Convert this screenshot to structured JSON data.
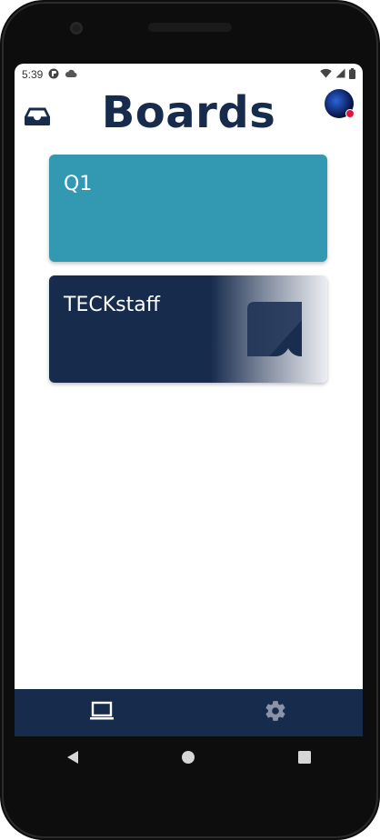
{
  "status_bar": {
    "time": "5:39",
    "icons": [
      "pocket-icon",
      "cloud-icon",
      "wifi-icon",
      "signal-icon",
      "battery-icon"
    ]
  },
  "header": {
    "title": "Boards",
    "left_icon": "inbox-icon",
    "avatar": "user-avatar"
  },
  "boards": [
    {
      "name": "Q1",
      "color": "#3398b2"
    },
    {
      "name": "TECKstaff",
      "color": "#172b4d"
    }
  ],
  "bottom_nav": {
    "items": [
      {
        "icon": "laptop-icon",
        "active": true
      },
      {
        "icon": "gear-icon",
        "active": false
      }
    ],
    "background": "#172b4d"
  },
  "system_nav": [
    "back-icon",
    "home-icon",
    "recents-icon"
  ],
  "colors": {
    "title": "#172b4d",
    "accent": "#3398b2",
    "notification_dot": "#e0143c"
  }
}
